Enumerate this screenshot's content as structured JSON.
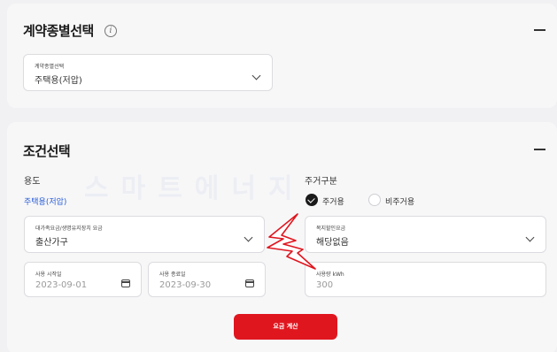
{
  "contract": {
    "title": "계약종별선택",
    "info_icon": "i",
    "select_label": "계약종별선택",
    "select_value": "주택용(저압)"
  },
  "conditions": {
    "title": "조건선택",
    "usage_label": "용도",
    "usage_value": "주택용(저압)",
    "residence_label": "주거구분",
    "residence_options": [
      "주거용",
      "비주거용"
    ],
    "residence_selected": "주거용",
    "large_family": {
      "label": "대가족요금/생명유지장치 요금",
      "value": "출산가구"
    },
    "welfare": {
      "label": "복지할인요금",
      "value": "해당없음"
    },
    "start_date": {
      "label": "사용 시작일",
      "value": "2023-09-01"
    },
    "end_date": {
      "label": "사용 종료일",
      "value": "2023-09-30"
    },
    "usage_amount": {
      "label": "사용량 kWh",
      "placeholder": "300"
    },
    "calc_button": "요금 계산"
  },
  "colors": {
    "accent_red": "#e0161f",
    "link_blue": "#2b5fd9",
    "bolt_red": "#e0161f"
  },
  "icons": [
    "info-icon",
    "collapse-icon",
    "chevron-down-icon",
    "calendar-icon",
    "check-icon",
    "lightning-bolt-icon"
  ]
}
